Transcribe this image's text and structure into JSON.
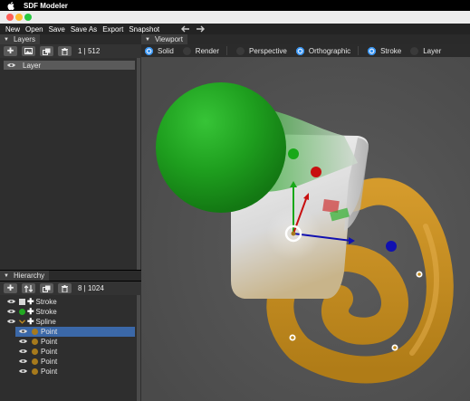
{
  "system_bar": {
    "app_name": "SDF Modeler"
  },
  "menu": {
    "items": [
      "New",
      "Open",
      "Save",
      "Save As",
      "Export",
      "Snapshot"
    ],
    "back_icon": "arrow-left-icon",
    "forward_icon": "arrow-right-icon"
  },
  "layers_panel": {
    "title": "Layers",
    "toolbar_icons": [
      "plus-icon",
      "image-icon",
      "duplicate-icon",
      "trash-icon"
    ],
    "count": "1 | 512",
    "items": [
      {
        "label": "Layer",
        "visible": true
      }
    ]
  },
  "hierarchy_panel": {
    "title": "Hierarchy",
    "toolbar_icons": [
      "plus-icon",
      "swap-icon",
      "duplicate-icon",
      "trash-icon"
    ],
    "count": "8 | 1024",
    "items": [
      {
        "label": "Stroke",
        "kind": "stroke",
        "swatch": "#d8d8d8",
        "depth": 0
      },
      {
        "label": "Stroke",
        "kind": "stroke",
        "swatch": "#22a822",
        "depth": 0
      },
      {
        "label": "Spline",
        "kind": "spline",
        "swatch": "#c08a1e",
        "depth": 0,
        "expanded": true
      },
      {
        "label": "Point",
        "kind": "point",
        "swatch": "#a77a1c",
        "depth": 1,
        "selected": true
      },
      {
        "label": "Point",
        "kind": "point",
        "swatch": "#a77a1c",
        "depth": 1
      },
      {
        "label": "Point",
        "kind": "point",
        "swatch": "#a77a1c",
        "depth": 1
      },
      {
        "label": "Point",
        "kind": "point",
        "swatch": "#a77a1c",
        "depth": 1
      },
      {
        "label": "Point",
        "kind": "point",
        "swatch": "#a77a1c",
        "depth": 1
      }
    ]
  },
  "viewport": {
    "title": "Viewport",
    "shading": {
      "options": [
        "Solid",
        "Render"
      ],
      "selected": "Solid"
    },
    "projection": {
      "options": [
        "Perspective",
        "Orthographic"
      ],
      "selected": "Orthographic"
    },
    "edit_mode": {
      "options": [
        "Stroke",
        "Layer"
      ],
      "selected": "Stroke"
    }
  },
  "colors": {
    "accent": "#2a8ef0",
    "selection": "#3b68a8",
    "sphere_green": "#22a822",
    "spline_gold": "#c08a1e",
    "cube_white": "#d8d8d8",
    "gizmo_red": "#c81010",
    "gizmo_green": "#18a818",
    "gizmo_blue": "#1010b0"
  }
}
